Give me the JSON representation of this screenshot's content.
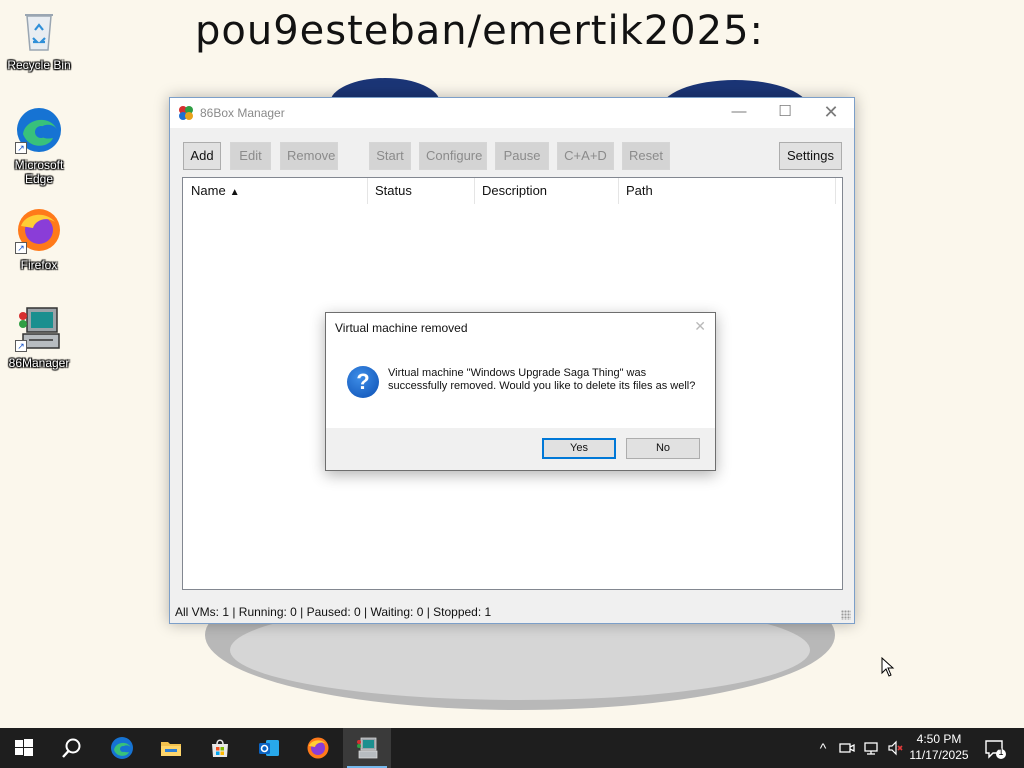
{
  "desktop": {
    "wallpaper_caption": "pou9esteban/emertik2025:",
    "icons": [
      {
        "label": "Recycle Bin"
      },
      {
        "label": "Microsoft Edge"
      },
      {
        "label": "Firefox"
      },
      {
        "label": "86Manager"
      }
    ]
  },
  "window": {
    "title": "86Box Manager",
    "controls": {
      "minimize": "—",
      "maximize": "☐",
      "close": "✕"
    },
    "toolbar": {
      "add": "Add",
      "edit": "Edit",
      "remove": "Remove",
      "start": "Start",
      "configure": "Configure",
      "pause": "Pause",
      "cad": "C+A+D",
      "reset": "Reset",
      "settings": "Settings"
    },
    "columns": {
      "name": "Name",
      "sort_indicator": "▲",
      "status": "Status",
      "description": "Description",
      "path": "Path"
    },
    "status_bar": "All VMs: 1 | Running: 0 | Paused: 0 | Waiting: 0 | Stopped: 1"
  },
  "dialog": {
    "title": "Virtual machine removed",
    "close": "✕",
    "icon_symbol": "?",
    "message": "Virtual machine \"Windows Upgrade Saga Thing\" was successfully removed. Would you like to delete its files as well?",
    "yes_label": "Yes",
    "no_label": "No"
  },
  "taskbar": {
    "start_icon": "windows-logo",
    "tray": {
      "chevron": "^",
      "time": "4:50 PM",
      "date": "11/17/2025",
      "notification_count": "1"
    }
  },
  "colors": {
    "accent": "#0078d7",
    "taskbar": "#1e1e1e",
    "window_border": "#7c9fc9"
  }
}
